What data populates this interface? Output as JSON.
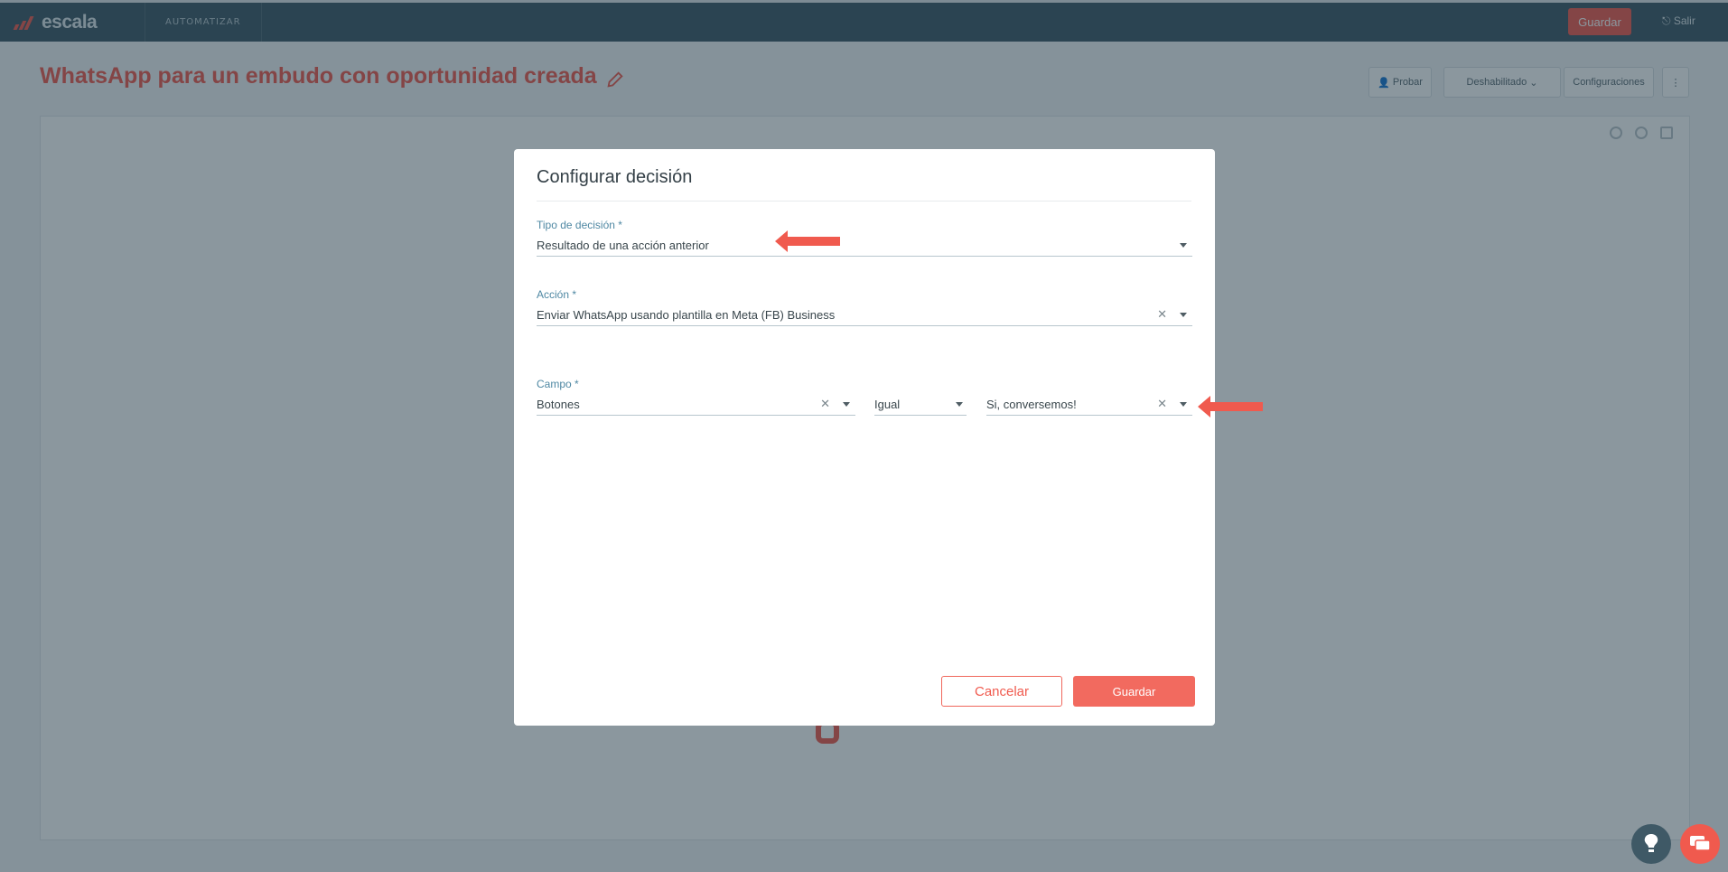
{
  "app": {
    "logo_text": "escala",
    "section_tab": "AUTOMATIZAR",
    "top_save": "Guardar",
    "top_exit": "Salir"
  },
  "page": {
    "title": "WhatsApp para un embudo con oportunidad creada",
    "buttons": {
      "test": "Probar",
      "status": "Deshabilitado",
      "config": "Configuraciones"
    }
  },
  "modal": {
    "title": "Configurar decisión",
    "decision_type": {
      "label": "Tipo de decisión *",
      "value": "Resultado de una acción anterior"
    },
    "action": {
      "label": "Acción *",
      "value": "Enviar WhatsApp usando plantilla en Meta (FB) Business"
    },
    "field": {
      "label": "Campo *",
      "value": "Botones"
    },
    "operator": {
      "value": "Igual"
    },
    "match_value": {
      "value": "Si, conversemos!"
    },
    "cancel_label": "Cancelar",
    "save_label": "Guardar"
  },
  "colors": {
    "accent": "#f05a4e",
    "topbar": "#3f5966",
    "label": "#4f88a3"
  }
}
